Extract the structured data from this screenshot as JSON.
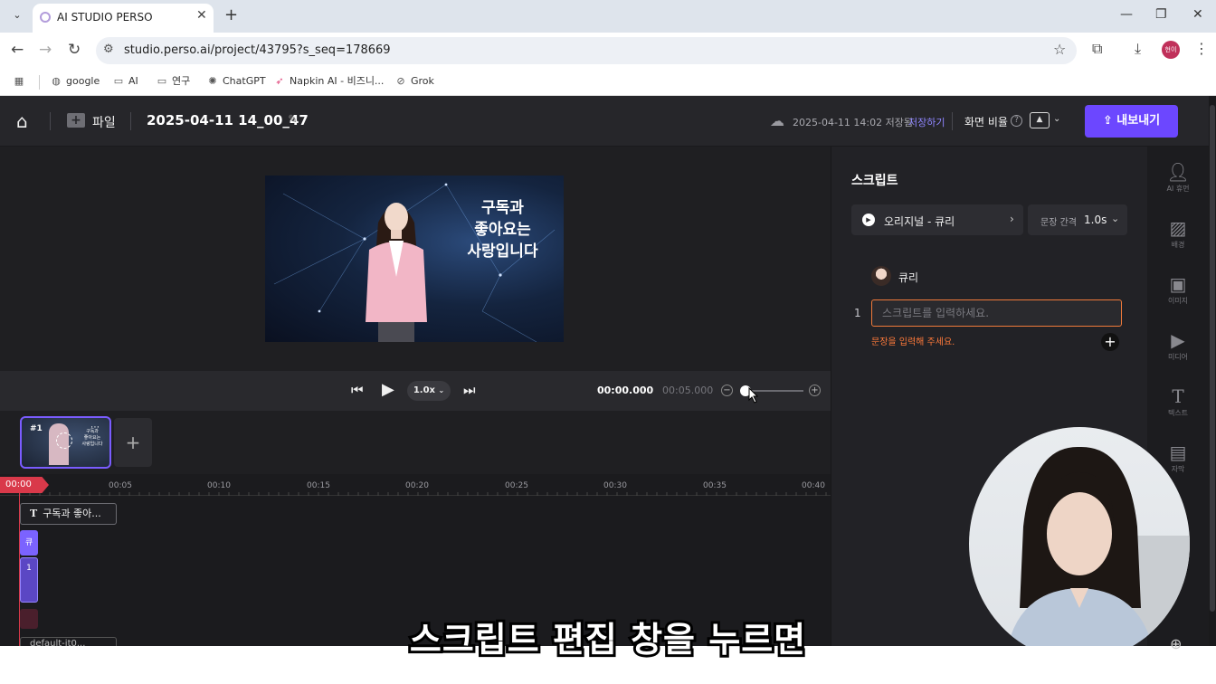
{
  "browser": {
    "tab_title": "AI STUDIO PERSO",
    "url": "studio.perso.ai/project/43795?s_seq=178669",
    "bookmarks": [
      {
        "icon": "globe-icon",
        "label": "google"
      },
      {
        "icon": "folder-icon",
        "label": "AI"
      },
      {
        "icon": "folder-icon",
        "label": "연구"
      },
      {
        "icon": "chatgpt-icon",
        "label": "ChatGPT"
      },
      {
        "icon": "napkin-icon",
        "label": "Napkin AI - 비즈니..."
      },
      {
        "icon": "grok-icon",
        "label": "Grok"
      }
    ],
    "profile_initials": "현이"
  },
  "header": {
    "file_label": "파일",
    "project_title": "2025-04-11 14_00_47",
    "saved_status": "2025-04-11 14:02 저장됨",
    "save_link": "저장하기",
    "ratio_label": "화면 비율",
    "export_label": "내보내기"
  },
  "preview": {
    "caption": "구독과\n좋아요는\n사랑입니다"
  },
  "controls": {
    "speed": "1.0x",
    "current_time": "00:00.000",
    "total_time": "00:05.000"
  },
  "scenes": [
    {
      "number": "#1",
      "thumb_caption": "구독과\n좋아요는\n사랑입니다"
    }
  ],
  "timeline": {
    "playhead": "00:00",
    "ticks": [
      "00:05",
      "00:10",
      "00:15",
      "00:20",
      "00:25",
      "00:30",
      "00:35",
      "00:40"
    ],
    "text_track": "구독과 좋아...",
    "avatar_track": "큐",
    "voice_track": "1",
    "bgm_track": "default-it0..."
  },
  "script_panel": {
    "title": "스크립트",
    "voice_label": "오리지널 - 큐리",
    "gap_label": "문장 간격",
    "gap_value": "1.0s",
    "speaker_name": "큐리",
    "line_number": "1",
    "input_placeholder": "스크립트를 입력하세요.",
    "error_text": "문장을 입력해 주세요."
  },
  "rail": [
    {
      "icon": "person-icon",
      "label": "AI 휴먼"
    },
    {
      "icon": "background-icon",
      "label": "배경"
    },
    {
      "icon": "image-icon",
      "label": "이미지"
    },
    {
      "icon": "video-icon",
      "label": "미디어"
    },
    {
      "icon": "text-icon",
      "label": "텍스트"
    },
    {
      "icon": "subtitle-icon",
      "label": "자막"
    }
  ],
  "video_subtitle": "스크립트 편집 창을 누르면",
  "colors": {
    "accent": "#6c47ff",
    "playhead": "#d9394a",
    "error": "#ff7a3a"
  }
}
